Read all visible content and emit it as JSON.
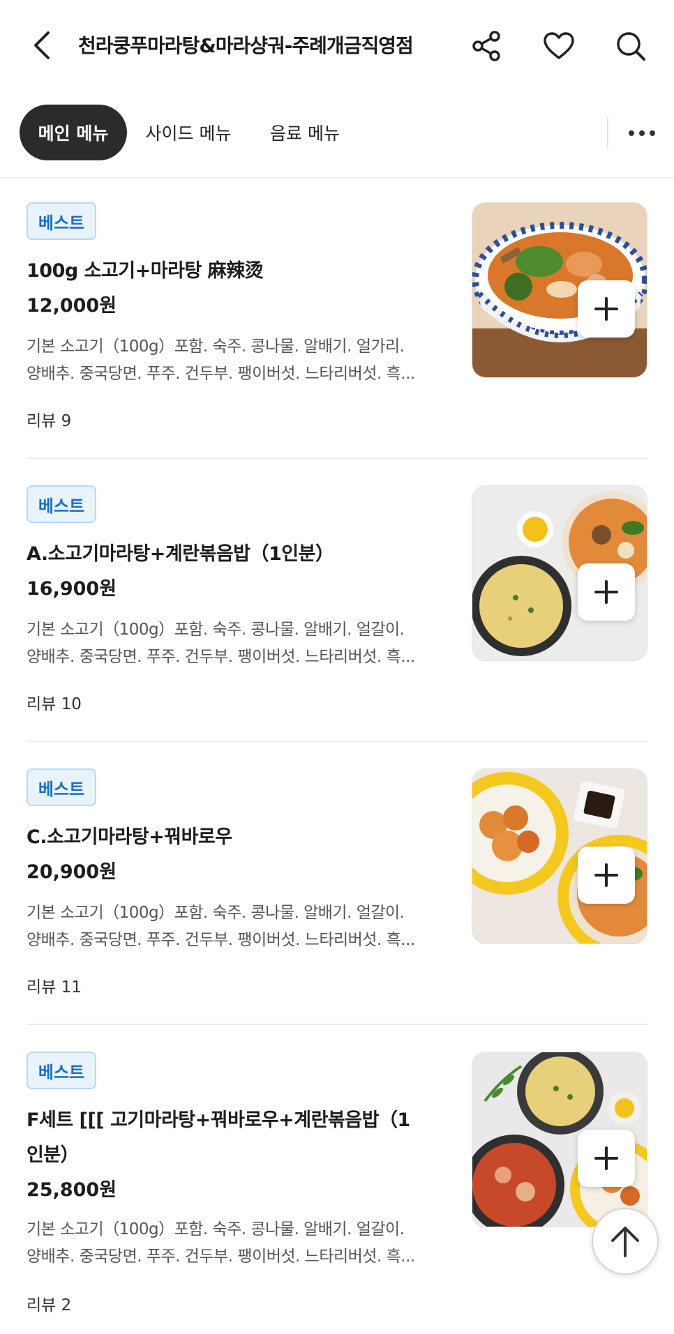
{
  "header": {
    "title": "천라쿵푸마라탕&마라샹궈-주례개금직영점",
    "icons": [
      "back-arrow-icon",
      "share-icon",
      "heart-icon",
      "search-icon"
    ]
  },
  "tabs": [
    {
      "label": "메인 메뉴",
      "active": true
    },
    {
      "label": "사이드 메뉴",
      "active": false
    },
    {
      "label": "음료 메뉴",
      "active": false
    }
  ],
  "menu": [
    {
      "badge": "베스트",
      "name": "100g 소고기+마라탕 麻辣烫",
      "price": "12,000원",
      "desc_line1": "기본 소고기（100g）포함. 숙주. 콩나물. 알배기. 얼가리.",
      "desc_line2": "양배추. 중국당면. 푸주. 건두부. 팽이버섯. 느타리버섯. 흑...",
      "review": "리뷰 9"
    },
    {
      "badge": "베스트",
      "name": "A.소고기마라탕+계란볶음밥（1인분）",
      "price": "16,900원",
      "desc_line1": "기본 소고기（100g）포함. 숙주. 콩나물. 알배기. 얼갈이.",
      "desc_line2": "양배추. 중국당면. 푸주. 건두부. 팽이버섯. 느타리버섯. 흑...",
      "review": "리뷰 10"
    },
    {
      "badge": "베스트",
      "name": "C.소고기마라탕+꿔바로우",
      "price": "20,900원",
      "desc_line1": "기본 소고기（100g）포함. 숙주. 콩나물. 알배기. 얼갈이.",
      "desc_line2": "양배추. 중국당면. 푸주. 건두부. 팽이버섯. 느타리버섯. 흑...",
      "review": "리뷰 11"
    },
    {
      "badge": "베스트",
      "name": "F세트 [[[ 고기마라탕+꿔바로우+계란볶음밥（1인분）",
      "price": "25,800원",
      "desc_line1": "기본 소고기（100g）포함. 숙주. 콩나물. 알배기. 얼갈이.",
      "desc_line2": "양배추. 중국당면. 푸주. 건두부. 팽이버섯. 느타리버섯. 흑...",
      "review": "리뷰 2"
    }
  ],
  "colors": {
    "active_tab_bg": "#2b2b2b",
    "badge_text": "#1a6fc0",
    "badge_bg": "#e8f3fd"
  }
}
